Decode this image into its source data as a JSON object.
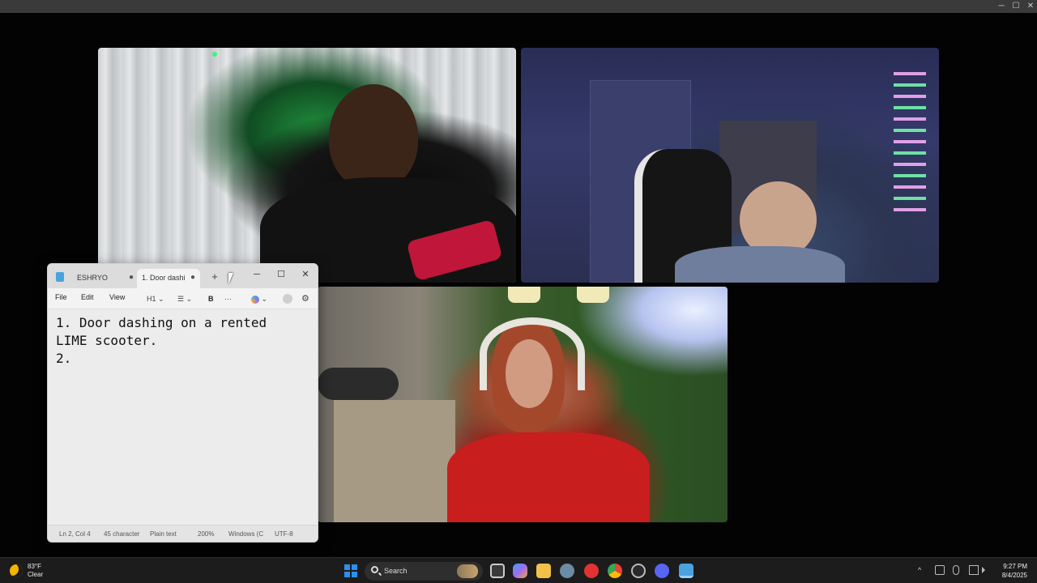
{
  "host_window": {
    "minimize": "─",
    "maximize": "☐",
    "close": "✕"
  },
  "notepad": {
    "tabs": [
      {
        "label": "ESHRYO",
        "dot": "●"
      },
      {
        "label": "1. Door dashi",
        "dot": "●"
      }
    ],
    "new_tab": "+",
    "controls": {
      "minimize": "─",
      "maximize": "☐",
      "close": "✕"
    },
    "menu": {
      "file": "File",
      "edit": "Edit",
      "view": "View"
    },
    "toolbar": {
      "heading": "H1 ⌄",
      "list": "☰ ⌄",
      "bold": "B",
      "more": "···",
      "copilot": "⌄",
      "settings": "⚙"
    },
    "content": [
      "1. Door dashing on a rented",
      "LIME scooter.",
      "2."
    ],
    "status": {
      "position": "Ln 2, Col 4",
      "characters": "45 character",
      "format": "Plain text",
      "zoom": "200%",
      "line_ending": "Windows (C",
      "encoding": "UTF-8"
    }
  },
  "taskbar": {
    "weather_temp": "83°F",
    "weather_desc": "Clear",
    "search_label": "Search",
    "clock_time": "9:27 PM",
    "clock_date": "8/4/2025",
    "tray_overflow": "^"
  },
  "colors": {
    "start_blue": "#2b8ff0",
    "notepad_bg": "#ececec",
    "taskbar_bg": "#1c1c1c"
  }
}
